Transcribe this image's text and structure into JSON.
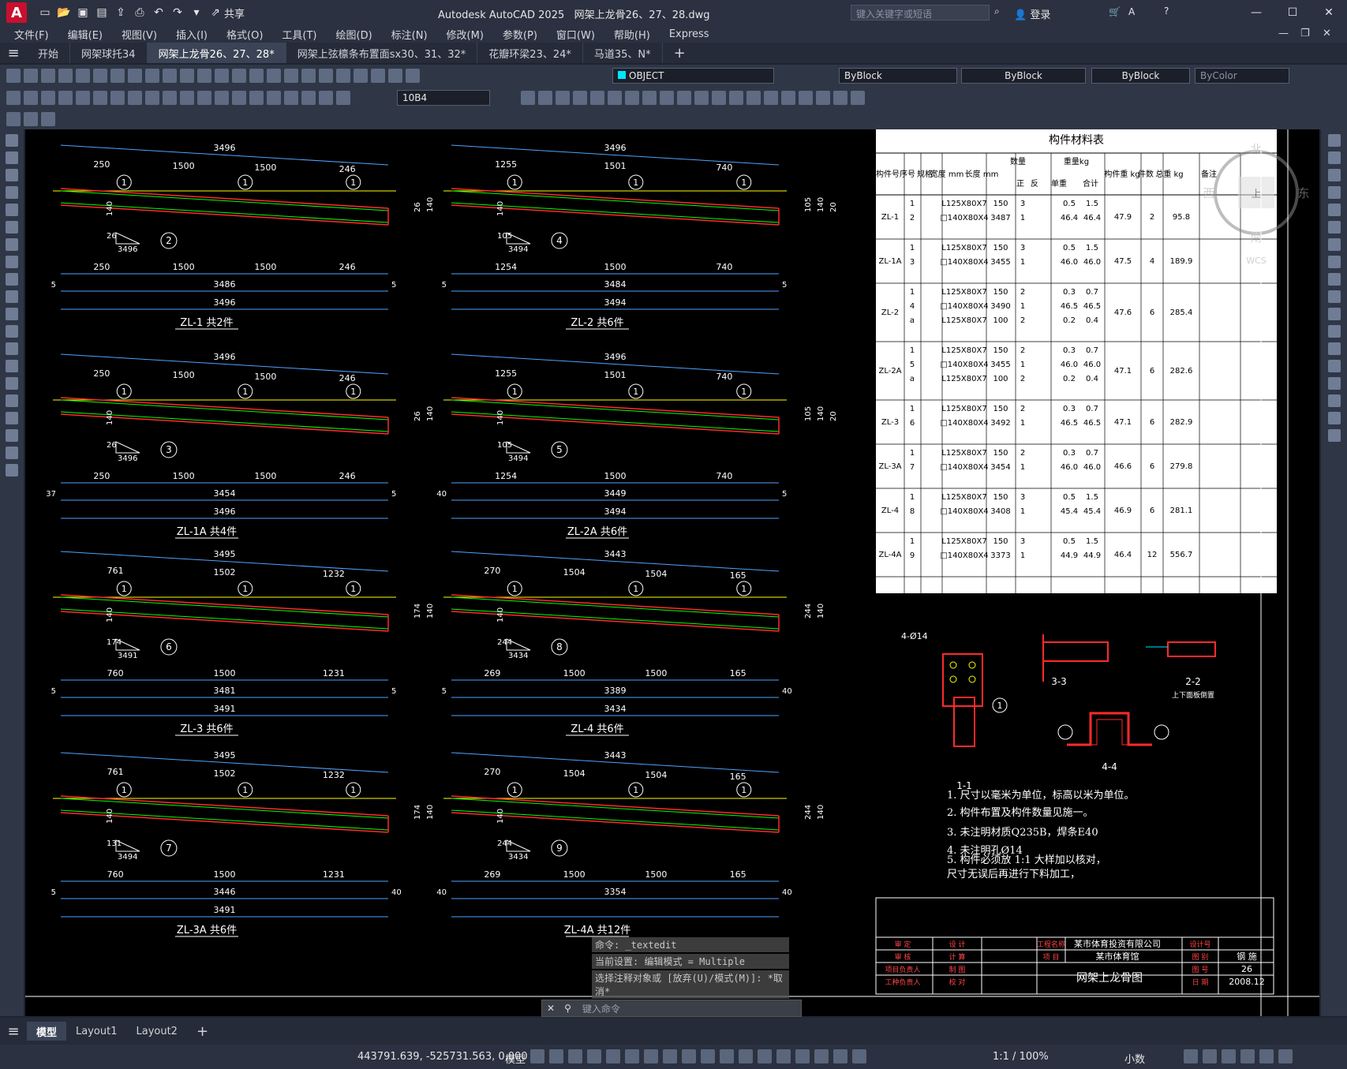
{
  "app": {
    "logo": "A",
    "title": "Autodesk AutoCAD 2025",
    "file": "网架上龙骨26、27、28.dwg",
    "share": "共享",
    "search_placeholder": "键入关键字或短语",
    "login": "登录"
  },
  "menu": [
    "文件(F)",
    "编辑(E)",
    "视图(V)",
    "插入(I)",
    "格式(O)",
    "工具(T)",
    "绘图(D)",
    "标注(N)",
    "修改(M)",
    "参数(P)",
    "窗口(W)",
    "帮助(H)",
    "Express"
  ],
  "tabs": [
    "开始",
    "网架球托34",
    "网架上龙骨26、27、28*",
    "网架上弦檩条布置面sx30、31、32*",
    "花瓣环梁23、24*",
    "马道35、N*"
  ],
  "active_tab": 2,
  "toolbar": {
    "layer": "OBJECT",
    "color": "ByBlock",
    "linetype": "ByBlock",
    "lineweight": "ByBlock",
    "plotstyle": "ByColor",
    "dimstyle": "10B4"
  },
  "drawing": {
    "material_table_title": "构件材料表",
    "headers": [
      "构件号",
      "序号",
      "规格",
      "宽度 mm",
      "长度 mm",
      "数量",
      "正",
      "反",
      "重量kg",
      "单重",
      "合计",
      "构件重 kg",
      "件数",
      "总重 kg",
      "备注"
    ],
    "rows": [
      {
        "id": "ZL-1",
        "items": [
          [
            "1",
            "L125X80X7",
            "150",
            "3",
            "0.5",
            "1.5"
          ],
          [
            "2",
            "□140X80X4",
            "3487",
            "1",
            "46.4",
            "46.4"
          ]
        ],
        "weight": "47.9",
        "count": "2",
        "total": "95.8"
      },
      {
        "id": "ZL-1A",
        "items": [
          [
            "1",
            "L125X80X7",
            "150",
            "3",
            "0.5",
            "1.5"
          ],
          [
            "3",
            "□140X80X4",
            "3455",
            "1",
            "46.0",
            "46.0"
          ]
        ],
        "weight": "47.5",
        "count": "4",
        "total": "189.9"
      },
      {
        "id": "ZL-2",
        "items": [
          [
            "1",
            "L125X80X7",
            "150",
            "2",
            "0.3",
            "0.7"
          ],
          [
            "4",
            "□140X80X4",
            "3490",
            "1",
            "46.5",
            "46.5"
          ],
          [
            "a",
            "L125X80X7",
            "100",
            "2",
            "0.2",
            "0.4"
          ]
        ],
        "weight": "47.6",
        "count": "6",
        "total": "285.4"
      },
      {
        "id": "ZL-2A",
        "items": [
          [
            "1",
            "L125X80X7",
            "150",
            "2",
            "0.3",
            "0.7"
          ],
          [
            "5",
            "□140X80X4",
            "3455",
            "1",
            "46.0",
            "46.0"
          ],
          [
            "a",
            "L125X80X7",
            "100",
            "2",
            "0.2",
            "0.4"
          ]
        ],
        "weight": "47.1",
        "count": "6",
        "total": "282.6"
      },
      {
        "id": "ZL-3",
        "items": [
          [
            "1",
            "L125X80X7",
            "150",
            "2",
            "0.3",
            "0.7"
          ],
          [
            "6",
            "□140X80X4",
            "3492",
            "1",
            "46.5",
            "46.5"
          ]
        ],
        "weight": "47.1",
        "count": "6",
        "total": "282.9"
      },
      {
        "id": "ZL-3A",
        "items": [
          [
            "1",
            "L125X80X7",
            "150",
            "2",
            "0.3",
            "0.7"
          ],
          [
            "7",
            "□140X80X4",
            "3454",
            "1",
            "46.0",
            "46.0"
          ]
        ],
        "weight": "46.6",
        "count": "6",
        "total": "279.8"
      },
      {
        "id": "ZL-4",
        "items": [
          [
            "1",
            "L125X80X7",
            "150",
            "3",
            "0.5",
            "1.5"
          ],
          [
            "8",
            "□140X80X4",
            "3408",
            "1",
            "45.4",
            "45.4"
          ]
        ],
        "weight": "46.9",
        "count": "6",
        "total": "281.1"
      },
      {
        "id": "ZL-4A",
        "items": [
          [
            "1",
            "L125X80X7",
            "150",
            "3",
            "0.5",
            "1.5"
          ],
          [
            "9",
            "□140X80X4",
            "3373",
            "1",
            "44.9",
            "44.9"
          ]
        ],
        "weight": "46.4",
        "count": "12",
        "total": "556.7"
      }
    ],
    "parts": [
      {
        "label": "ZL-1 共2件",
        "top": "3496",
        "mid": "3486",
        "bot": "3496",
        "segs": [
          "250",
          "1500",
          "1500",
          "246"
        ],
        "bsegs": [
          "250",
          "1500",
          "1500",
          "246"
        ],
        "slope": "26",
        "slope_len": "3496",
        "tag": "2",
        "h": "140",
        "left_end": "5",
        "right_end": "5",
        "right_dims": [
          "26",
          "140"
        ]
      },
      {
        "label": "ZL-2 共6件",
        "top": "3496",
        "mid": "3484",
        "bot": "3494",
        "segs": [
          "1255",
          "1501",
          "740"
        ],
        "bsegs": [
          "1254",
          "1500",
          "740"
        ],
        "slope": "105",
        "slope_len": "3494",
        "tag": "4",
        "h": "140",
        "left_end": "5",
        "right_end": "5",
        "right_dims": [
          "105",
          "140",
          "20"
        ]
      },
      {
        "label": "ZL-1A 共4件",
        "top": "3496",
        "mid": "3454",
        "bot": "3496",
        "segs": [
          "250",
          "1500",
          "1500",
          "246"
        ],
        "bsegs": [
          "250",
          "1500",
          "1500",
          "246"
        ],
        "slope": "26",
        "slope_len": "3496",
        "tag": "3",
        "h": "140",
        "left_end": "37",
        "right_end": "5",
        "right_dims": [
          "26",
          "140"
        ]
      },
      {
        "label": "ZL-2A 共6件",
        "top": "3496",
        "mid": "3449",
        "bot": "3494",
        "segs": [
          "1255",
          "1501",
          "740"
        ],
        "bsegs": [
          "1254",
          "1500",
          "740"
        ],
        "slope": "105",
        "slope_len": "3494",
        "tag": "5",
        "h": "140",
        "left_end": "40",
        "right_end": "5",
        "right_dims": [
          "105",
          "140",
          "20"
        ]
      },
      {
        "label": "ZL-3 共6件",
        "top": "3495",
        "mid": "3481",
        "bot": "3491",
        "segs": [
          "761",
          "1502",
          "1232"
        ],
        "bsegs": [
          "760",
          "1500",
          "1231"
        ],
        "slope": "174",
        "slope_len": "3491",
        "tag": "6",
        "h": "140",
        "left_end": "5",
        "right_end": "5",
        "right_dims": [
          "174",
          "140"
        ]
      },
      {
        "label": "ZL-4 共6件",
        "top": "3443",
        "mid": "3389",
        "bot": "3434",
        "segs": [
          "270",
          "1504",
          "1504",
          "165"
        ],
        "bsegs": [
          "269",
          "1500",
          "1500",
          "165"
        ],
        "slope": "244",
        "slope_len": "3434",
        "tag": "8",
        "h": "140",
        "left_end": "5",
        "right_end": "40",
        "right_dims": [
          "244",
          "140"
        ]
      },
      {
        "label": "ZL-3A 共6件",
        "top": "3495",
        "mid": "3446",
        "bot": "3491",
        "segs": [
          "761",
          "1502",
          "1232"
        ],
        "bsegs": [
          "760",
          "1500",
          "1231"
        ],
        "slope": "131",
        "slope_len": "3494",
        "tag": "7",
        "h": "140",
        "left_end": "5",
        "right_end": "40",
        "right_dims": [
          "174",
          "140"
        ]
      },
      {
        "label": "ZL-4A 共12件",
        "top": "3443",
        "mid": "3354",
        "bot": "",
        "segs": [
          "270",
          "1504",
          "1504",
          "165"
        ],
        "bsegs": [
          "269",
          "1500",
          "1500",
          "165"
        ],
        "slope": "244",
        "slope_len": "3434",
        "tag": "9",
        "h": "140",
        "left_end": "40",
        "right_end": "40",
        "right_dims": [
          "244",
          "140"
        ]
      }
    ],
    "notes": [
      "1. 尺寸以毫米为单位，标高以米为单位。",
      "2. 构件布置及构件数量见施一。",
      "3. 未注明材质Q235B，焊条E40",
      "4. 未注明孔Ø14",
      "5. 构件必须放 1:1 大样加以核对，",
      "   尺寸无误后再进行下料加工，"
    ],
    "details": {
      "d11": "1-1",
      "d22": "2-2",
      "d22sub": "上下面板倒置",
      "d33": "3-3",
      "d44": "4-4",
      "holes": "4-Ø14"
    },
    "titleblock": {
      "company": "某市体育投资有限公司",
      "project": "某市体育馆",
      "drawing_name": "网架上龙骨图",
      "prof": "钢 施",
      "sheet": "26",
      "date": "2008.12",
      "labels": [
        "审 定",
        "审 核",
        "项目负责人",
        "工种负责人",
        "设 计",
        "计 算",
        "制 图",
        "校 对",
        "工程名称",
        "项 目",
        "设计号",
        "图 别",
        "图 号",
        "日 期"
      ]
    },
    "compass": {
      "north": "北",
      "south": "南",
      "east": "东",
      "west": "西",
      "top": "上",
      "wcs": "WCS"
    }
  },
  "command": {
    "history": [
      "命令: _textedit",
      "当前设置: 编辑模式 = Multiple",
      "选择注释对象或 [放弃(U)/模式(M)]: *取消*"
    ],
    "placeholder": "键入命令"
  },
  "layouts": [
    "模型",
    "Layout1",
    "Layout2"
  ],
  "status": {
    "coords": "443791.639, -525731.563, 0.000",
    "model": "模型",
    "scale": "1:1 / 100%",
    "units": "小数"
  }
}
